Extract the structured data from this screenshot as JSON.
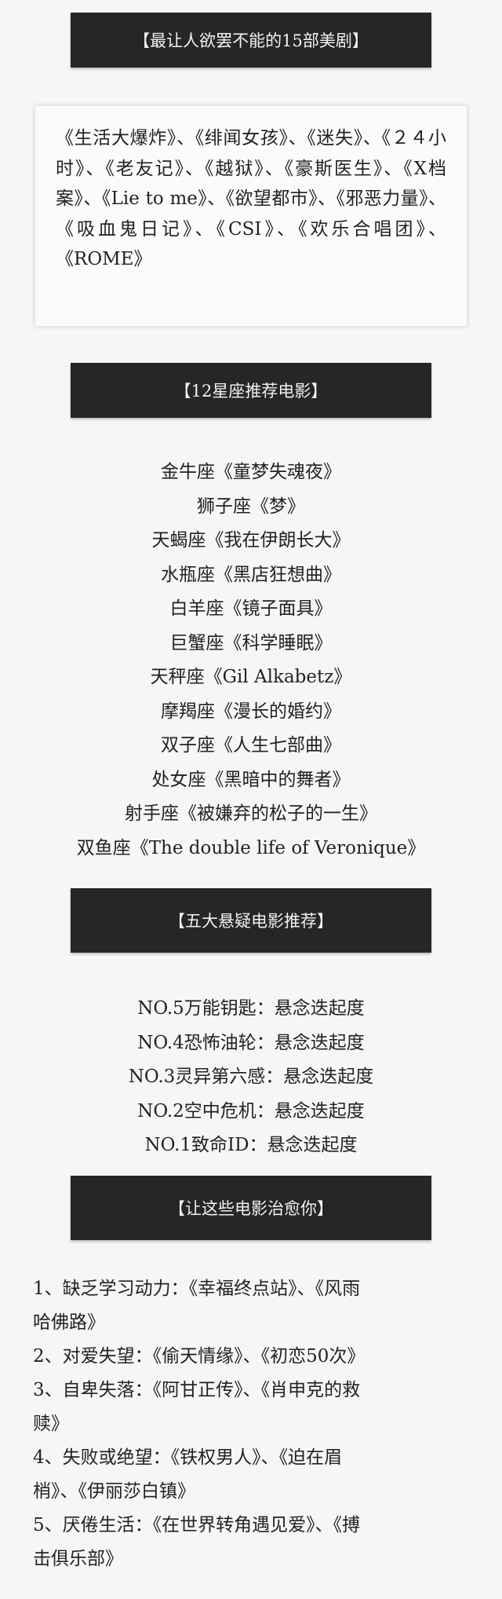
{
  "section1": {
    "title": "【最让人欲罢不能的15部美剧】",
    "body": "《生活大爆炸》、《绯闻女孩》、《迷失》、《２４小时》、《老友记》、《越狱》、《豪斯医生》、《X档案》、《Lie to me》、《欲望都市》、《邪恶力量》、《吸血鬼日记》、《CSI》、《欢乐合唱团》、《ROME》"
  },
  "section2": {
    "title": "【12星座推荐电影】",
    "items": [
      "金牛座《童梦失魂夜》",
      "狮子座《梦》",
      "天蝎座《我在伊朗长大》",
      "水瓶座《黑店狂想曲》",
      "白羊座《镜子面具》",
      "巨蟹座《科学睡眠》",
      "天秤座《Gil Alkabetz》",
      "摩羯座《漫长的婚约》",
      "双子座《人生七部曲》",
      "处女座《黑暗中的舞者》",
      "射手座《被嫌弃的松子的一生》",
      "双鱼座《The double life of Veronique》"
    ]
  },
  "section3": {
    "title": "【五大悬疑电影推荐】",
    "items": [
      "NO.5万能钥匙：悬念迭起度",
      "NO.4恐怖油轮：悬念迭起度",
      "NO.3灵异第六感：悬念迭起度",
      "NO.2空中危机：悬念迭起度",
      "NO.1致命ID：悬念迭起度"
    ]
  },
  "section4": {
    "title": "【让这些电影治愈你】",
    "items": [
      {
        "first": "1、缺乏学习动力：《幸福终点站》、《风雨",
        "second": "哈佛路》"
      },
      {
        "first": "2、对爱失望：《偷天情缘》、《初恋50次》",
        "second": ""
      },
      {
        "first": "3、自卑失落：《阿甘正传》、《肖申克的救",
        "second": "赎》"
      },
      {
        "first": "4、失败或绝望：《铁权男人》、《迫在眉",
        "second": "梢》、《伊丽莎白镇》"
      },
      {
        "first": "5、厌倦生活：《在世界转角遇见爱》、《搏",
        "second": "击俱乐部》"
      }
    ]
  }
}
